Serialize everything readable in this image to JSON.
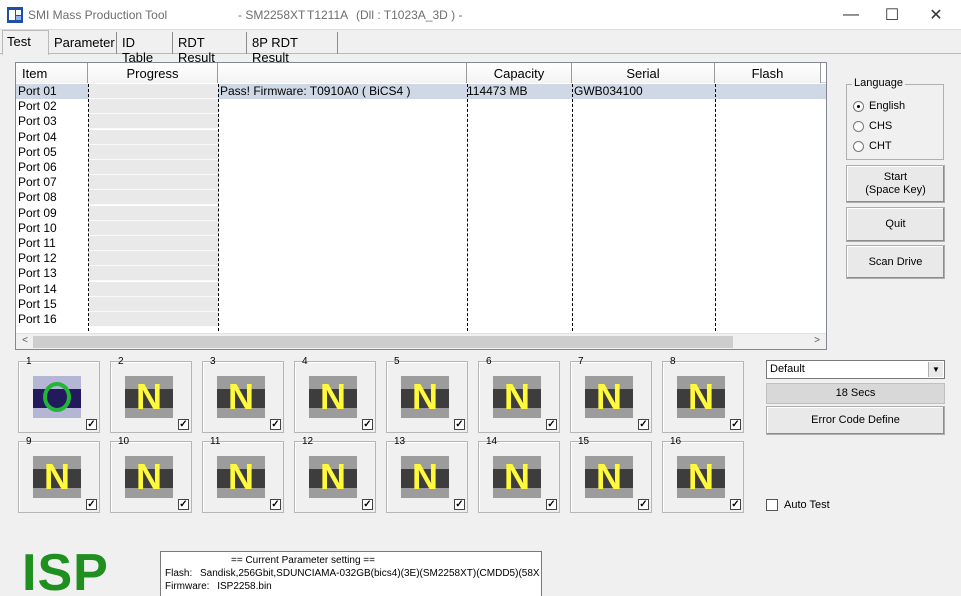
{
  "window": {
    "title": "SMI Mass Production Tool",
    "controller": "- SM2258XT",
    "version": "T1211A",
    "dll": "(Dll : T1023A_3D ) -",
    "minimize": "—",
    "maximize": "☐",
    "close": "✕"
  },
  "tabs": [
    "Test",
    "Parameter",
    "ID Table",
    "RDT Result",
    "8P RDT Result"
  ],
  "list": {
    "columns": [
      "Item",
      "Progress",
      "",
      "Capacity",
      "Serial",
      "Flash"
    ],
    "rows": [
      {
        "item": "Port 01",
        "status": "Pass!  Firmware: T0910A0  ( BiCS4 )",
        "capacity": "114473 MB",
        "serial": "GWB034100",
        "flash": ""
      },
      {
        "item": "Port 02"
      },
      {
        "item": "Port 03"
      },
      {
        "item": "Port 04"
      },
      {
        "item": "Port 05"
      },
      {
        "item": "Port 06"
      },
      {
        "item": "Port 07"
      },
      {
        "item": "Port 08"
      },
      {
        "item": "Port 09"
      },
      {
        "item": "Port 10"
      },
      {
        "item": "Port 11"
      },
      {
        "item": "Port 12"
      },
      {
        "item": "Port 13"
      },
      {
        "item": "Port 14"
      },
      {
        "item": "Port 15"
      },
      {
        "item": "Port 16"
      }
    ],
    "scroll_left": "<",
    "scroll_right": ">"
  },
  "language": {
    "title": "Language",
    "options": [
      "English",
      "CHS",
      "CHT"
    ],
    "selected": "English"
  },
  "buttons": {
    "start_line1": "Start",
    "start_line2": "(Space Key)",
    "quit": "Quit",
    "scan": "Scan Drive",
    "error_code": "Error Code Define"
  },
  "ports": [
    {
      "n": "1",
      "state": "O"
    },
    {
      "n": "2",
      "state": "N"
    },
    {
      "n": "3",
      "state": "N"
    },
    {
      "n": "4",
      "state": "N"
    },
    {
      "n": "5",
      "state": "N"
    },
    {
      "n": "6",
      "state": "N"
    },
    {
      "n": "7",
      "state": "N"
    },
    {
      "n": "8",
      "state": "N"
    },
    {
      "n": "9",
      "state": "N"
    },
    {
      "n": "10",
      "state": "N"
    },
    {
      "n": "11",
      "state": "N"
    },
    {
      "n": "12",
      "state": "N"
    },
    {
      "n": "13",
      "state": "N"
    },
    {
      "n": "14",
      "state": "N"
    },
    {
      "n": "15",
      "state": "N"
    },
    {
      "n": "16",
      "state": "N"
    }
  ],
  "profile": {
    "selected": "Default",
    "drop": "▼"
  },
  "timer": "18 Secs",
  "auto_test": "Auto Test",
  "logo": "ISP",
  "parameters": {
    "header": "== Current Parameter setting ==",
    "flash_label": "Flash:",
    "flash_value": "Sandisk,256Gbit,SDUNCIAMA-032GB(bics4)(3E)(SM2258XT)(CMDD5)(58X",
    "firmware_label": "Firmware:",
    "firmware_value": "ISP2258.bin"
  },
  "colors": {
    "pass_ring": "#22b537",
    "letter": "#fff93c",
    "logo": "#1f8f1f",
    "selection": "#cfd9e6"
  }
}
